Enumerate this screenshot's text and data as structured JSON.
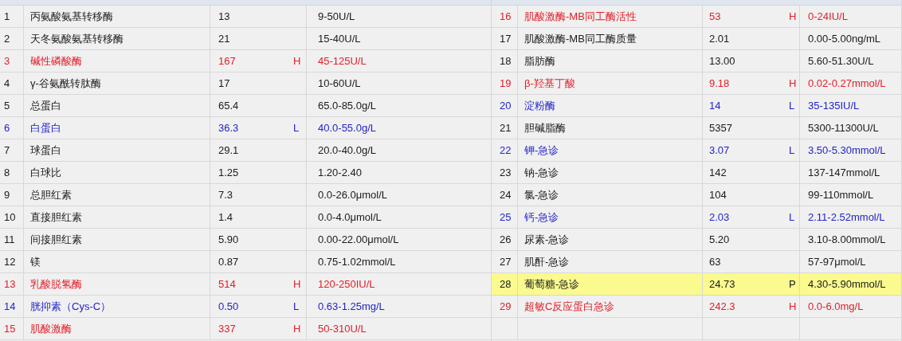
{
  "tables": [
    {
      "rows": [
        {
          "no": "1",
          "name": "丙氨酸氨基转移酶",
          "result": "13",
          "reference": "9-50U/L",
          "kind": "normal"
        },
        {
          "no": "2",
          "name": "天冬氨酸氨基转移酶",
          "result": "21",
          "reference": "15-40U/L",
          "kind": "normal"
        },
        {
          "no": "3",
          "name": "碱性磷酸酶",
          "result": "167",
          "flag": "H",
          "reference": "45-125U/L",
          "kind": "high"
        },
        {
          "no": "4",
          "name": "γ-谷氨酰转肽酶",
          "result": "17",
          "reference": "10-60U/L",
          "kind": "normal"
        },
        {
          "no": "5",
          "name": "总蛋白",
          "result": "65.4",
          "reference": "65.0-85.0g/L",
          "kind": "normal"
        },
        {
          "no": "6",
          "name": "白蛋白",
          "result": "36.3",
          "flag": "L",
          "reference": "40.0-55.0g/L",
          "kind": "low"
        },
        {
          "no": "7",
          "name": "球蛋白",
          "result": "29.1",
          "reference": "20.0-40.0g/L",
          "kind": "normal"
        },
        {
          "no": "8",
          "name": "白球比",
          "result": "1.25",
          "reference": "1.20-2.40",
          "kind": "normal"
        },
        {
          "no": "9",
          "name": "总胆红素",
          "result": "7.3",
          "reference": "0.0-26.0μmol/L",
          "kind": "normal"
        },
        {
          "no": "10",
          "name": "直接胆红素",
          "result": "1.4",
          "reference": "0.0-4.0μmol/L",
          "kind": "normal"
        },
        {
          "no": "11",
          "name": "间接胆红素",
          "result": "5.90",
          "reference": "0.00-22.00μmol/L",
          "kind": "normal"
        },
        {
          "no": "12",
          "name": "镁",
          "result": "0.87",
          "reference": "0.75-1.02mmol/L",
          "kind": "normal"
        },
        {
          "no": "13",
          "name": "乳酸脱氢酶",
          "result": "514",
          "flag": "H",
          "reference": "120-250IU/L",
          "kind": "high"
        },
        {
          "no": "14",
          "name": "胱抑素（Cys-C）",
          "result": "0.50",
          "flag": "L",
          "reference": "0.63-1.25mg/L",
          "kind": "low"
        },
        {
          "no": "15",
          "name": "肌酸激酶",
          "result": "337",
          "flag": "H",
          "reference": "50-310U/L",
          "kind": "high"
        }
      ]
    },
    {
      "rows": [
        {
          "no": "16",
          "name": "肌酸激酶-MB同工酶活性",
          "result": "53",
          "flag": "H",
          "reference": "0-24IU/L",
          "kind": "high"
        },
        {
          "no": "17",
          "name": "肌酸激酶-MB同工酶质量",
          "result": "2.01",
          "reference": "0.00-5.00ng/mL",
          "kind": "normal"
        },
        {
          "no": "18",
          "name": "脂肪酶",
          "result": "13.00",
          "reference": "5.60-51.30U/L",
          "kind": "normal"
        },
        {
          "no": "19",
          "name": "β-羟基丁酸",
          "result": "9.18",
          "flag": "H",
          "reference": "0.02-0.27mmol/L",
          "kind": "high"
        },
        {
          "no": "20",
          "name": "淀粉酶",
          "result": "14",
          "flag": "L",
          "reference": "35-135IU/L",
          "kind": "low"
        },
        {
          "no": "21",
          "name": "胆碱脂酶",
          "result": "5357",
          "reference": "5300-11300U/L",
          "kind": "normal"
        },
        {
          "no": "22",
          "name": "钾-急诊",
          "result": "3.07",
          "flag": "L",
          "reference": "3.50-5.30mmol/L",
          "kind": "low"
        },
        {
          "no": "23",
          "name": "钠-急诊",
          "result": "142",
          "reference": "137-147mmol/L",
          "kind": "normal"
        },
        {
          "no": "24",
          "name": "氯-急诊",
          "result": "104",
          "reference": "99-110mmol/L",
          "kind": "normal"
        },
        {
          "no": "25",
          "name": "钙-急诊",
          "result": "2.03",
          "flag": "L",
          "reference": "2.11-2.52mmol/L",
          "kind": "low"
        },
        {
          "no": "26",
          "name": "尿素-急诊",
          "result": "5.20",
          "reference": "3.10-8.00mmol/L",
          "kind": "normal"
        },
        {
          "no": "27",
          "name": "肌酐-急诊",
          "result": "63",
          "reference": "57-97μmol/L",
          "kind": "normal"
        },
        {
          "no": "28",
          "name": "葡萄糖-急诊",
          "result": "24.73",
          "flag": "P",
          "reference": "4.30-5.90mmol/L",
          "kind": "positive"
        },
        {
          "no": "29",
          "name": "超敏C反应蛋白急诊",
          "result": "242.3",
          "flag": "H",
          "reference": "0.0-6.0mg/L",
          "kind": "high"
        }
      ]
    }
  ]
}
